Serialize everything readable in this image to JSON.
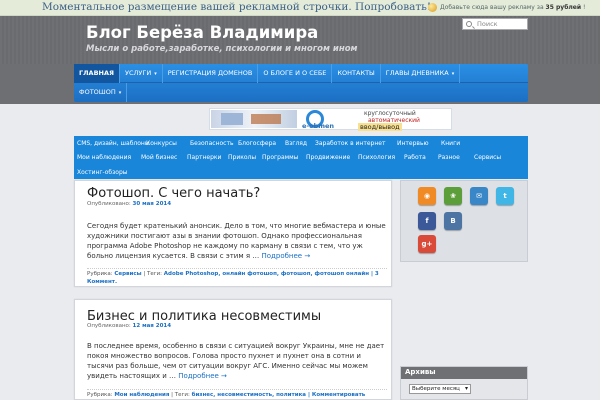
{
  "topbar": {
    "ad_text": "Моментальное размещение вашей рекламной строчки. Попробовать!",
    "ad_right_prefix": "Добавьте сюда вашу рекламу за ",
    "ad_right_price": "35 рублей",
    "ad_right_suffix": " !"
  },
  "header": {
    "title": "Блог Берёза Владимира",
    "description": "Мысли о работе,заработке, психологии и многом ином",
    "search_placeholder": "Поиск"
  },
  "nav": {
    "row1": [
      "ГЛАВНАЯ",
      "УСЛУГИ",
      "РЕГИСТРАЦИЯ ДОМЕНОВ",
      "О БЛОГЕ И О СЕБЕ",
      "КОНТАКТЫ",
      "ГЛАВЫ ДНЕВНИКА"
    ],
    "row2": [
      "ФОТОШОП"
    ],
    "dropdown_caret": "▾"
  },
  "banner": {
    "brand": "e-obmen",
    "line1": "круглосуточный",
    "line2": "автоматический",
    "line3": "ввод/вывод"
  },
  "categories": {
    "row1": [
      "CMS, дизайн, шаблоны",
      "Конкурсы",
      "Безопасность",
      "Блогосфера",
      "Взгляд",
      "Заработок в интернет",
      "Интервью",
      "Книги"
    ],
    "row2": [
      "Мои наблюдения",
      "Мой бизнес",
      "Партнерки",
      "Приколы",
      "Программы",
      "Продвижение",
      "Психология",
      "Работа",
      "Разное",
      "Сервисы"
    ],
    "row3": [
      "Хостинг-обзоры"
    ]
  },
  "posts": [
    {
      "title": "Фотошоп. С чего начать?",
      "published_label": "Опубликовано: ",
      "date": "30 мая 2014",
      "body": "Сегодня будет кратенький анонсик. Дело в том, что многие вебмастера и юные художники постигают азы в знании фотошоп. Однако профессиональная программа Adobe Photoshop не каждому по карману в связи с тем, что уж больно лицензия кусается. В связи с этим я … ",
      "more": "Подробнее →",
      "rubric_label": "Рубрика: ",
      "rubric": "Сервисы",
      "tags_label": " | Теги: ",
      "tags": "Adobe Photoshop, онлайн фотошоп, фотошоп, фотошоп онлайн",
      "comments": " | 3 Коммент."
    },
    {
      "title": "Бизнес и политика несовместимы",
      "published_label": "Опубликовано: ",
      "date": "12 мая 2014",
      "body": "В последнее время, особенно в связи с ситуацией вокруг Украины, мне не дает покоя множество вопросов. Голова просто пухнет и пухнет она в сотни и тысячи раз больше, чем от ситуации вокруг АГС. Именно сейчас мы можем увидеть настоящих и … ",
      "more": "Подробнее →",
      "rubric_label": "Рубрика: ",
      "rubric": "Мои наблюдения",
      "tags_label": " | Теги: ",
      "tags": "бизнес, несовместимость, политика",
      "comments": " | Комментировать"
    }
  ],
  "sidebar": {
    "social_icons": [
      {
        "name": "rss-icon",
        "color": "#f08a24",
        "glyph": "◉"
      },
      {
        "name": "feedburner-icon",
        "color": "#5c9e3a",
        "glyph": "❀"
      },
      {
        "name": "mail-icon",
        "color": "#3a87c8",
        "glyph": "✉"
      },
      {
        "name": "twitter-icon",
        "color": "#3fb6e6",
        "glyph": "t"
      },
      {
        "name": "facebook-icon",
        "color": "#3b5998",
        "glyph": "f"
      },
      {
        "name": "vkontakte-icon",
        "color": "#4c75a3",
        "glyph": "B"
      },
      {
        "name": "google-plus-icon",
        "color": "#d94a38",
        "glyph": "g+"
      }
    ],
    "archive_title": "Архивы",
    "archive_select": "Выберите месяц"
  },
  "colors": {
    "nav_blue": "#1c6fc3",
    "category_blue": "#1a86d9",
    "header_gray": "#6e6f73",
    "link_blue": "#1a6fc4"
  }
}
